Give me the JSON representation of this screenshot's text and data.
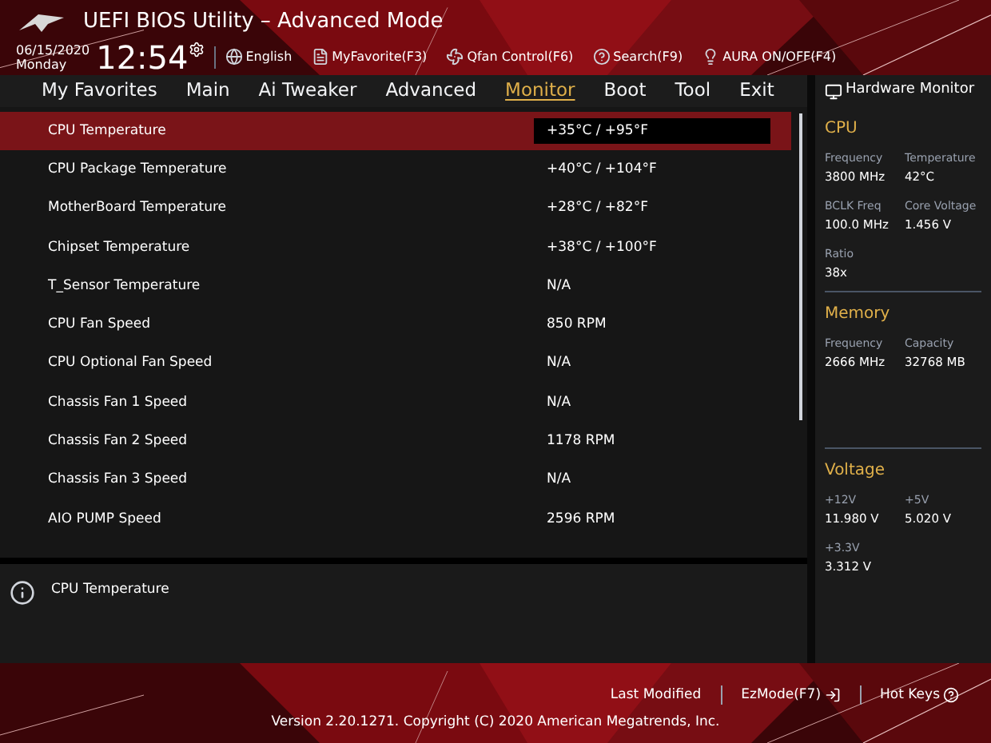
{
  "header": {
    "title": "UEFI BIOS Utility – Advanced Mode",
    "date": "06/15/2020",
    "day": "Monday",
    "time": "12:54",
    "tools": [
      {
        "kind": "language",
        "label": "English"
      },
      {
        "kind": "favorite",
        "label": "MyFavorite(F3)"
      },
      {
        "kind": "fan",
        "label": "Qfan Control(F6)"
      },
      {
        "kind": "search",
        "label": "Search(F9)"
      },
      {
        "kind": "aura",
        "label": "AURA ON/OFF(F4)"
      }
    ]
  },
  "tabs": [
    {
      "label": "My Favorites",
      "selected": false
    },
    {
      "label": "Main",
      "selected": false
    },
    {
      "label": "Ai Tweaker",
      "selected": false
    },
    {
      "label": "Advanced",
      "selected": false
    },
    {
      "label": "Monitor",
      "selected": true
    },
    {
      "label": "Boot",
      "selected": false
    },
    {
      "label": "Tool",
      "selected": false
    },
    {
      "label": "Exit",
      "selected": false
    }
  ],
  "items": [
    {
      "label": "CPU Temperature",
      "value": "+35°C / +95°F",
      "selected": true
    },
    {
      "label": "CPU Package Temperature",
      "value": "+40°C / +104°F",
      "selected": false
    },
    {
      "label": "MotherBoard Temperature",
      "value": "+28°C / +82°F",
      "selected": false
    },
    {
      "label": "Chipset Temperature",
      "value": "+38°C / +100°F",
      "selected": false
    },
    {
      "label": "T_Sensor Temperature",
      "value": "N/A",
      "selected": false
    },
    {
      "label": "CPU Fan Speed",
      "value": "850 RPM",
      "selected": false
    },
    {
      "label": "CPU Optional Fan Speed",
      "value": "N/A",
      "selected": false
    },
    {
      "label": "Chassis Fan 1 Speed",
      "value": "N/A",
      "selected": false
    },
    {
      "label": "Chassis Fan 2 Speed",
      "value": "1178 RPM",
      "selected": false
    },
    {
      "label": "Chassis Fan 3 Speed",
      "value": "N/A",
      "selected": false
    },
    {
      "label": "AIO PUMP Speed",
      "value": "2596 RPM",
      "selected": false
    }
  ],
  "help": {
    "text": "CPU Temperature"
  },
  "hardware_monitor": {
    "title": "Hardware Monitor",
    "sections": [
      {
        "title": "CPU",
        "readings": [
          {
            "label": "Frequency",
            "value": "3800 MHz"
          },
          {
            "label": "Temperature",
            "value": "42°C"
          },
          {
            "label": "BCLK Freq",
            "value": "100.0 MHz"
          },
          {
            "label": "Core Voltage",
            "value": "1.456 V"
          },
          {
            "label": "Ratio",
            "value": "38x"
          }
        ]
      },
      {
        "title": "Memory",
        "readings": [
          {
            "label": "Frequency",
            "value": "2666 MHz"
          },
          {
            "label": "Capacity",
            "value": "32768 MB"
          }
        ]
      },
      {
        "title": "Voltage",
        "readings": [
          {
            "label": "+12V",
            "value": "11.980 V"
          },
          {
            "label": "+5V",
            "value": "5.020 V"
          },
          {
            "label": "+3.3V",
            "value": "3.312 V"
          }
        ]
      }
    ]
  },
  "footer": {
    "actions": [
      {
        "kind": "last",
        "label": "Last Modified"
      },
      {
        "kind": "ezmode",
        "label": "EzMode(F7)"
      },
      {
        "kind": "hotkeys",
        "label": "Hot Keys"
      }
    ],
    "copyright": "Version 2.20.1271. Copyright (C) 2020 American Megatrends, Inc."
  }
}
